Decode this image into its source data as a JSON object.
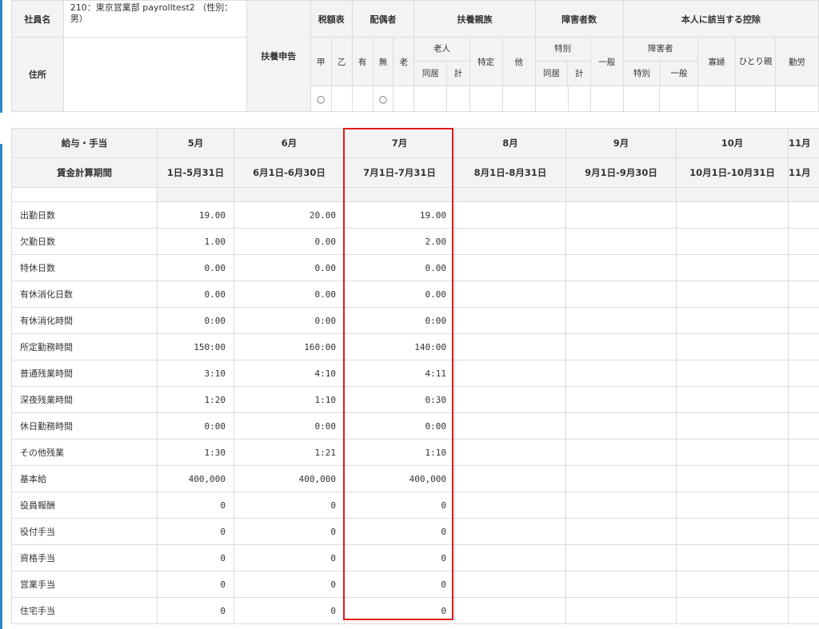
{
  "employee": {
    "label_name": "社員名",
    "name": "210：東京営業部 payrolltest2 （性別：男）",
    "label_address": "住所",
    "address": ""
  },
  "dependents": {
    "fuyo_shinkoku": "扶養申告",
    "zeigakuhyo": "税額表",
    "haigusha": "配偶者",
    "fuyo_shinzoku": "扶養親族",
    "shogaisha_su": "障害者数",
    "honnin_kojo": "本人に該当する控除",
    "ko": "甲",
    "otsu": "乙",
    "ari": "有",
    "nashi": "無",
    "ro": "老",
    "rojin": "老人",
    "tokutei": "特定",
    "hoka": "他",
    "tokubetsu": "特別",
    "ippan": "一般",
    "shogaisha": "障害者",
    "kafu": "寡婦",
    "hitorioya": "ひとり親",
    "kinro": "勤労",
    "dokyo": "同居",
    "kei": "計",
    "tokubetsu2": "特別",
    "ippan2": "一般",
    "mark_ko": "○",
    "mark_nashi": "○"
  },
  "monthly": {
    "header_row1_label": "給与・手当",
    "header_row2_label": "賃金計算期間",
    "months": [
      {
        "name": "5月",
        "period": "1日-5月31日"
      },
      {
        "name": "6月",
        "period": "6月1日-6月30日"
      },
      {
        "name": "7月",
        "period": "7月1日-7月31日"
      },
      {
        "name": "8月",
        "period": "8月1日-8月31日"
      },
      {
        "name": "9月",
        "period": "9月1日-9月30日"
      },
      {
        "name": "10月",
        "period": "10月1日-10月31日"
      },
      {
        "name": "11月",
        "period": "11月"
      }
    ],
    "rows": [
      {
        "label": "出勤日数",
        "values": [
          "19.00",
          "20.00",
          "19.00"
        ]
      },
      {
        "label": "欠勤日数",
        "values": [
          "1.00",
          "0.00",
          "2.00"
        ]
      },
      {
        "label": "特休日数",
        "values": [
          "0.00",
          "0.00",
          "0.00"
        ]
      },
      {
        "label": "有休消化日数",
        "values": [
          "0.00",
          "0.00",
          "0.00"
        ]
      },
      {
        "label": "有休消化時間",
        "values": [
          "0:00",
          "0:00",
          "0:00"
        ]
      },
      {
        "label": "所定勤務時間",
        "values": [
          "150:00",
          "160:00",
          "140:00"
        ]
      },
      {
        "label": "普通残業時間",
        "values": [
          "3:10",
          "4:10",
          "4:11"
        ]
      },
      {
        "label": "深夜残業時間",
        "values": [
          "1:20",
          "1:10",
          "0:30"
        ]
      },
      {
        "label": "休日勤務時間",
        "values": [
          "0:00",
          "0:00",
          "0:00"
        ]
      },
      {
        "label": "その他残業",
        "values": [
          "1:30",
          "1:21",
          "1:10"
        ]
      },
      {
        "label": "基本給",
        "values": [
          "400,000",
          "400,000",
          "400,000"
        ]
      },
      {
        "label": "役員報酬",
        "values": [
          "0",
          "0",
          "0"
        ]
      },
      {
        "label": "役付手当",
        "values": [
          "0",
          "0",
          "0"
        ]
      },
      {
        "label": "資格手当",
        "values": [
          "0",
          "0",
          "0"
        ]
      },
      {
        "label": "営業手当",
        "values": [
          "0",
          "0",
          "0"
        ]
      },
      {
        "label": "住宅手当",
        "values": [
          "0",
          "0",
          "0"
        ]
      }
    ]
  },
  "colors": {
    "highlight": "#e01b1b",
    "accent": "#2a88c8",
    "header_bg": "#f3f3f3"
  }
}
